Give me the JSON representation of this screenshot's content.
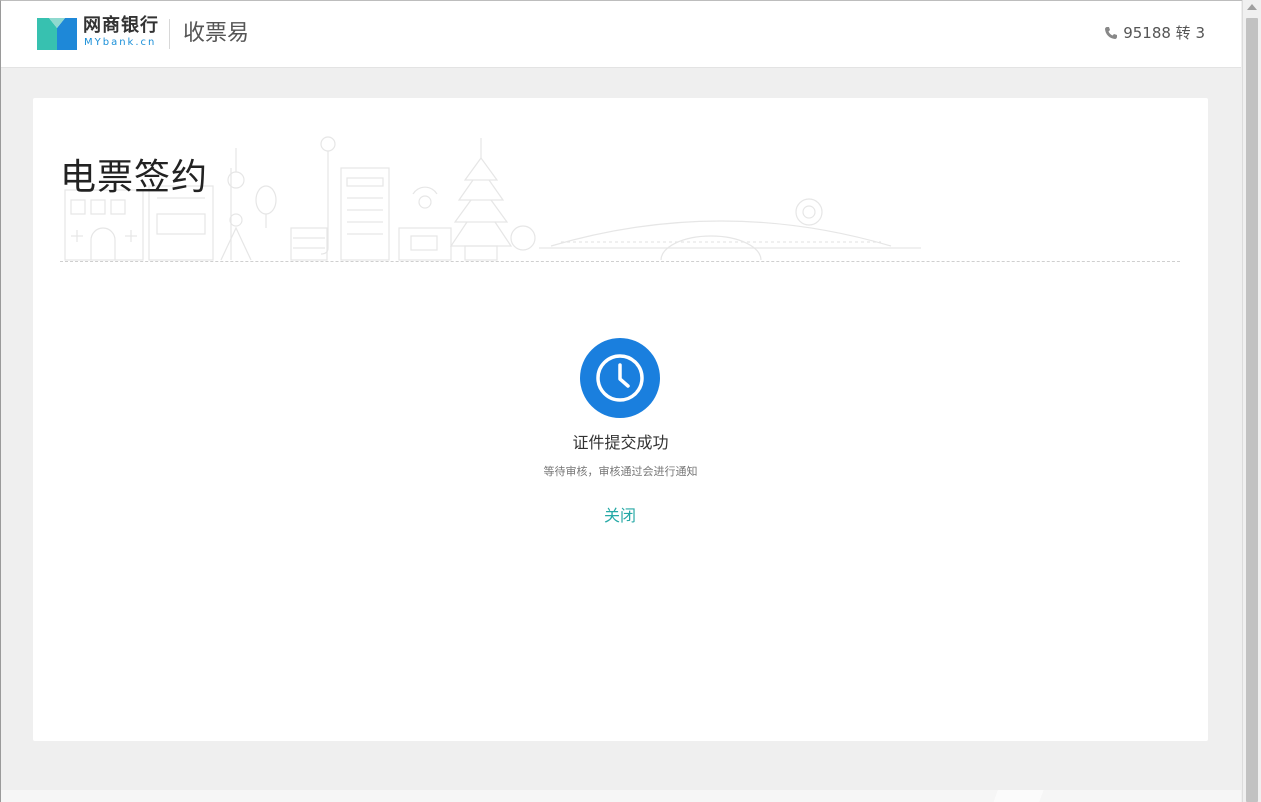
{
  "header": {
    "brand_cn": "网商银行",
    "brand_en": "MYbank.cn",
    "product_name": "收票易",
    "hotline": "95188 转 3"
  },
  "page": {
    "title": "电票签约"
  },
  "status": {
    "title": "证件提交成功",
    "description": "等待审核，审核通过会进行通知",
    "close_label": "关闭",
    "icon": "clock-icon"
  },
  "colors": {
    "accent_blue": "#1a7fde",
    "link_teal": "#27a9a6",
    "logo_teal": "#37c1b0",
    "logo_blue": "#1e88d8"
  }
}
